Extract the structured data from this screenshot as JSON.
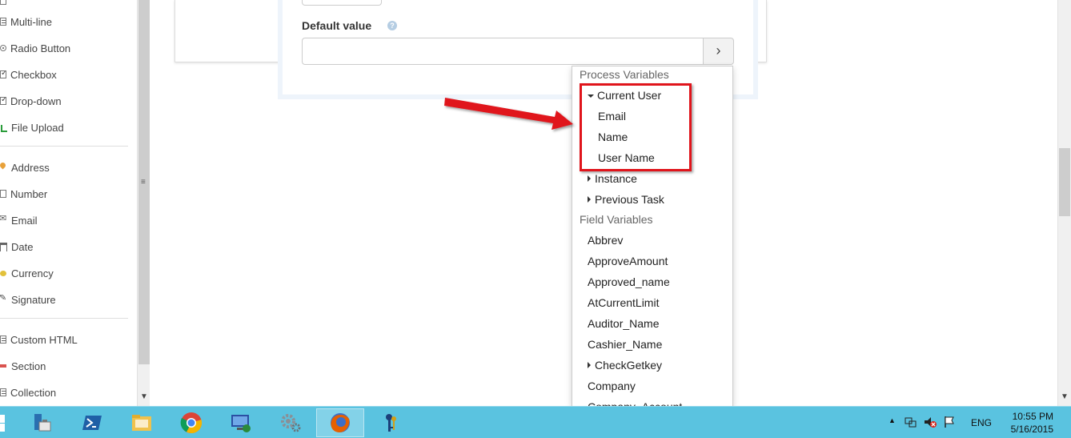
{
  "palette": {
    "items": [
      {
        "label": "Multi-line"
      },
      {
        "label": "Radio Button"
      },
      {
        "label": "Checkbox"
      },
      {
        "label": "Drop-down"
      },
      {
        "label": "File Upload"
      },
      {
        "label": "Address"
      },
      {
        "label": "Number"
      },
      {
        "label": "Email"
      },
      {
        "label": "Date"
      },
      {
        "label": "Currency"
      },
      {
        "label": "Signature"
      },
      {
        "label": "Custom HTML"
      },
      {
        "label": "Section"
      },
      {
        "label": "Collection"
      }
    ]
  },
  "field_settings": {
    "default_value_label": "Default value",
    "help_icon": "?",
    "default_value": "",
    "picker_button": "›"
  },
  "variables_menu": {
    "process_header": "Process Variables",
    "current_user": "Current User",
    "current_user_children": [
      "Email",
      "Name",
      "User Name"
    ],
    "instance": "Instance",
    "previous_task": "Previous Task",
    "field_header": "Field Variables",
    "fields": [
      "Abbrev",
      "ApproveAmount",
      "Approved_name",
      "AtCurrentLimit",
      "Auditor_Name",
      "Cashier_Name",
      "CheckGetkey",
      "Company",
      "Company_Account"
    ]
  },
  "taskbar": {
    "tray": {
      "language": "ENG",
      "time": "10:55 PM",
      "date": "5/16/2015"
    }
  },
  "colors": {
    "highlight": "#e0141b",
    "taskbar": "#5ac3e0"
  }
}
